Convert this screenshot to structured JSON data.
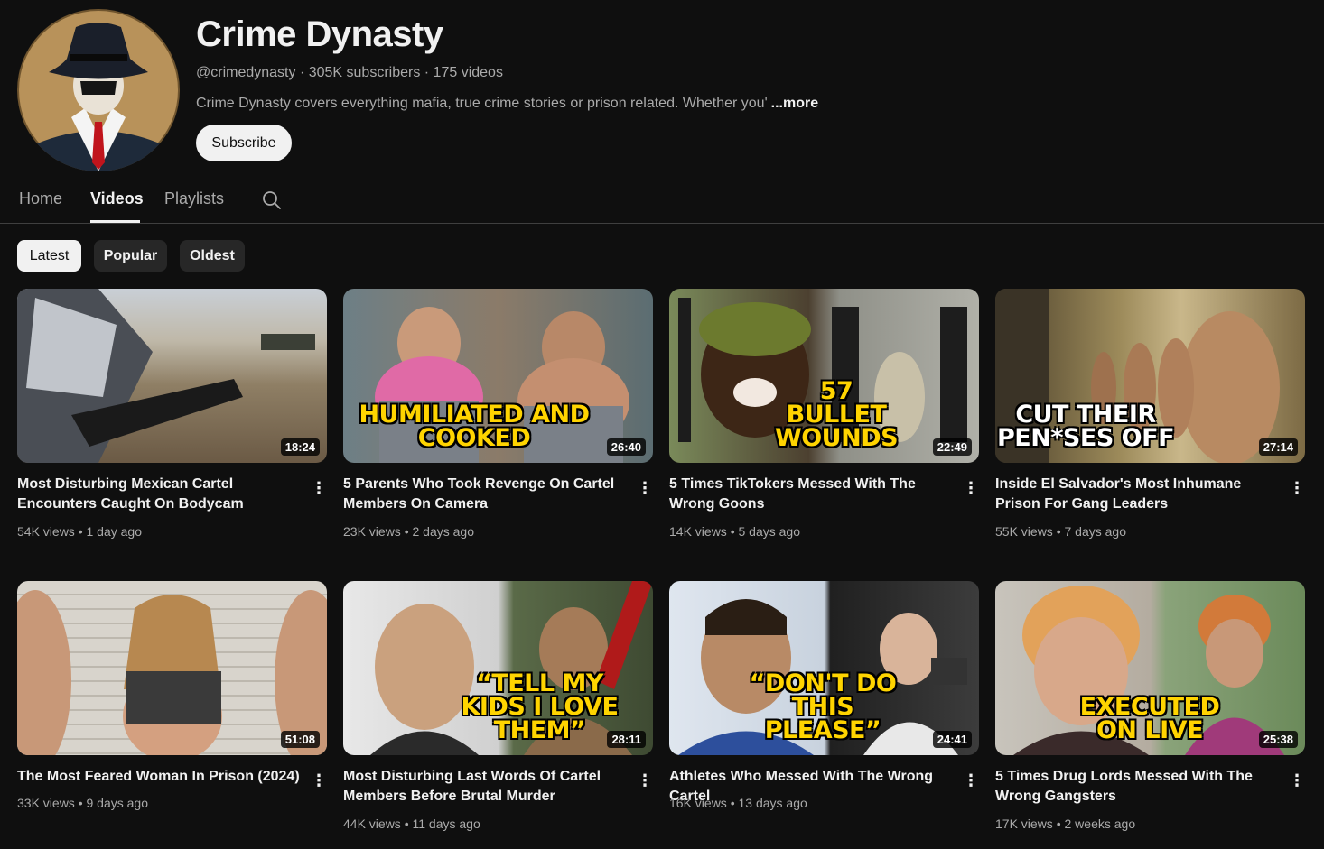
{
  "channel": {
    "title": "Crime Dynasty",
    "meta": "@crimedynasty · 305K subscribers · 175 videos",
    "description": "Crime Dynasty covers everything mafia, true crime stories or prison related. Whether you",
    "description_fade": "'",
    "more_label": "...more",
    "subscribe_label": "Subscribe"
  },
  "tabs": [
    {
      "label": "Home"
    },
    {
      "label": "Videos"
    },
    {
      "label": "Playlists"
    }
  ],
  "chips": [
    {
      "label": "Latest"
    },
    {
      "label": "Popular"
    },
    {
      "label": "Oldest"
    }
  ],
  "videos": [
    {
      "title": "Most Disturbing Mexican Cartel Encounters Caught On Bodycam",
      "views": "54K views",
      "age": "1 day ago",
      "duration": "18:24",
      "overlay": ""
    },
    {
      "title": "5 Parents Who Took Revenge On Cartel Members On Camera",
      "views": "23K views",
      "age": "2 days ago",
      "duration": "26:40",
      "overlay": "HUMILIATED AND COOKED"
    },
    {
      "title": "5 Times TikTokers Messed With The Wrong Goons",
      "views": "14K views",
      "age": "5 days ago",
      "duration": "22:49",
      "overlay": "57 BULLET WOUNDS"
    },
    {
      "title": "Inside El Salvador's Most Inhumane Prison For Gang Leaders",
      "views": "55K views",
      "age": "7 days ago",
      "duration": "27:14",
      "overlay": "CUT THEIR PEN*SES OFF"
    },
    {
      "title": "The Most Feared Woman In Prison (2024)",
      "views": "33K views",
      "age": "9 days ago",
      "duration": "51:08",
      "overlay": ""
    },
    {
      "title": "Most Disturbing Last Words Of Cartel Members Before Brutal Murder",
      "views": "44K views",
      "age": "11 days ago",
      "duration": "28:11",
      "overlay": "“TELL MY KIDS I LOVE THEM”"
    },
    {
      "title": "Athletes Who Messed With The Wrong Cartel",
      "views": "16K views",
      "age": "13 days ago",
      "duration": "24:41",
      "overlay": "“DON'T DO THIS PLEASE”"
    },
    {
      "title": "5 Times Drug Lords Messed With The Wrong Gangsters",
      "views": "17K views",
      "age": "2 weeks ago",
      "duration": "25:38",
      "overlay": "EXECUTED ON LIVE"
    }
  ],
  "colors": {
    "background": "#0f0f0f",
    "text_primary": "#f1f1f1",
    "text_secondary": "#aaaaaa",
    "chip_bg": "#272727",
    "overlay_yellow": "#ffd400"
  }
}
